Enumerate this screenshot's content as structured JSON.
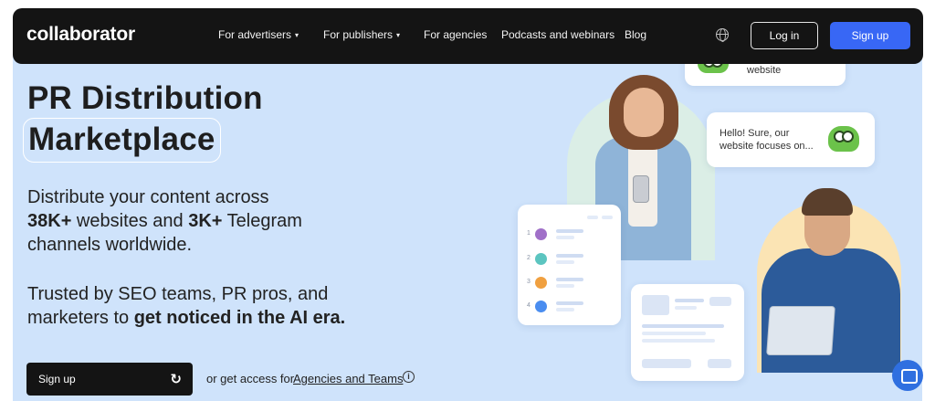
{
  "nav": {
    "logo": "collaborator",
    "links": [
      {
        "label": "For advertisers",
        "dropdown": true
      },
      {
        "label": "For publishers",
        "dropdown": true
      },
      {
        "label": "For agencies",
        "dropdown": false
      },
      {
        "label": "Podcasts and webinars",
        "dropdown": false
      },
      {
        "label": "Blog",
        "dropdown": false
      }
    ],
    "caret": "▾",
    "login_label": "Log in",
    "signup_label": "Sign up"
  },
  "hero": {
    "title_line1": "PR Distribution",
    "title_line2": "Marketplace",
    "desc": {
      "line1": "Distribute your content across",
      "line2_bold1": "38K+",
      "line2_mid": " websites and ",
      "line2_bold2": "3K+",
      "line2_end": " Telegram",
      "line3": "channels worldwide."
    },
    "trust": {
      "line1": "Trusted by SEO teams, PR pros, and",
      "line2_start": "marketers to ",
      "line2_bold": "get noticed in the AI era."
    },
    "cta_label": "Sign up",
    "cta_arrow": "↻",
    "or_text": "or get access for",
    "or_link": "Agencies and Teams",
    "info_glyph": "i"
  },
  "illustration": {
    "bubble_top": "website",
    "bubble_mid_line1": "Hello! Sure, our",
    "bubble_mid_line2": "website focuses on...",
    "list_numbers": [
      "1",
      "2",
      "3",
      "4"
    ],
    "list_dot_colors": [
      "#a070c8",
      "#5cc5c0",
      "#f0a040",
      "#4a8df0"
    ]
  },
  "colors": {
    "nav_bg": "#141414",
    "hero_bg": "#cfe3fb",
    "accent": "#3867f5"
  }
}
